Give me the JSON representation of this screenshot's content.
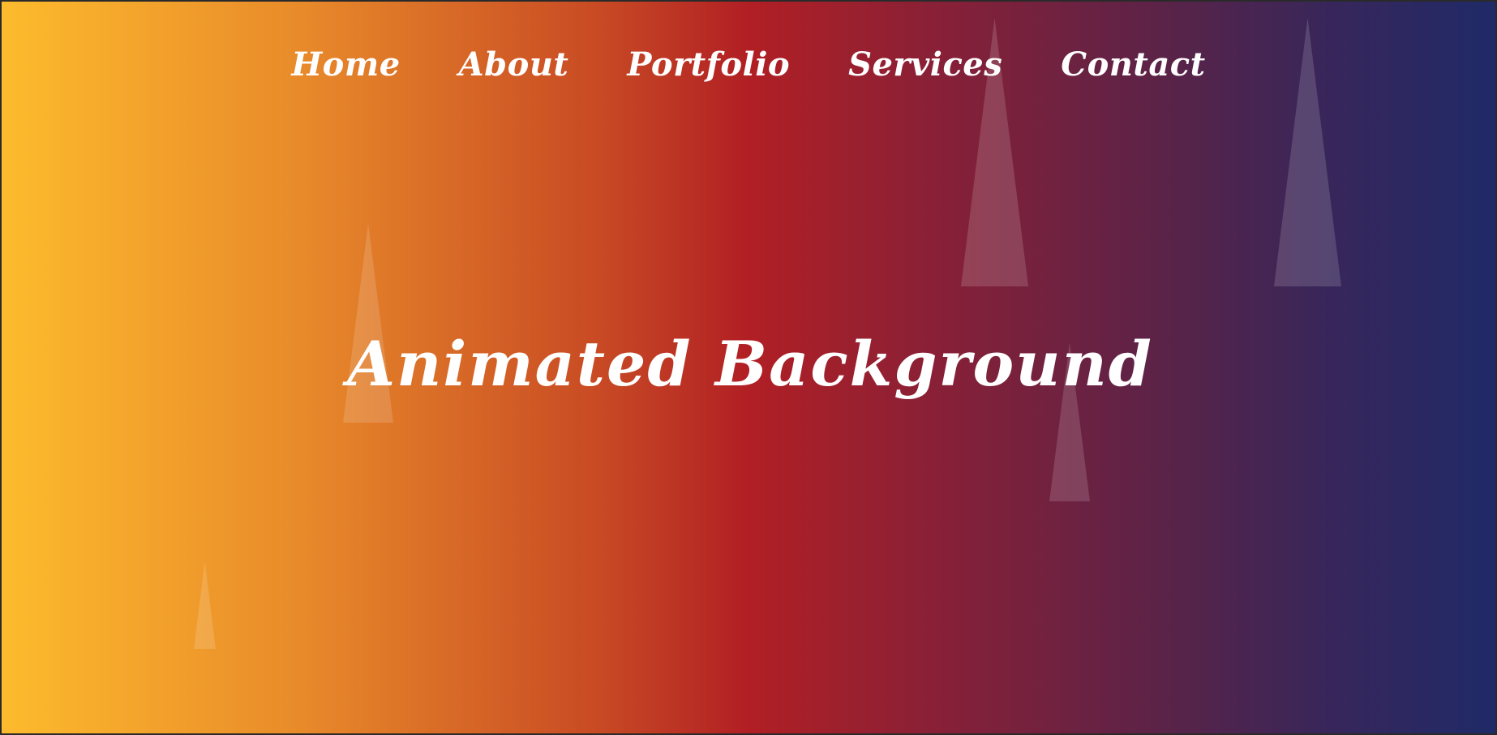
{
  "nav": {
    "items": [
      {
        "label": "Home"
      },
      {
        "label": "About"
      },
      {
        "label": "Portfolio"
      },
      {
        "label": "Services"
      },
      {
        "label": "Contact"
      }
    ]
  },
  "hero": {
    "title": "Animated Background"
  },
  "colors": {
    "gradient_start": "#fdbb2d",
    "gradient_mid": "#b11f24",
    "gradient_end": "#1f2a68",
    "text": "#ffffff"
  }
}
